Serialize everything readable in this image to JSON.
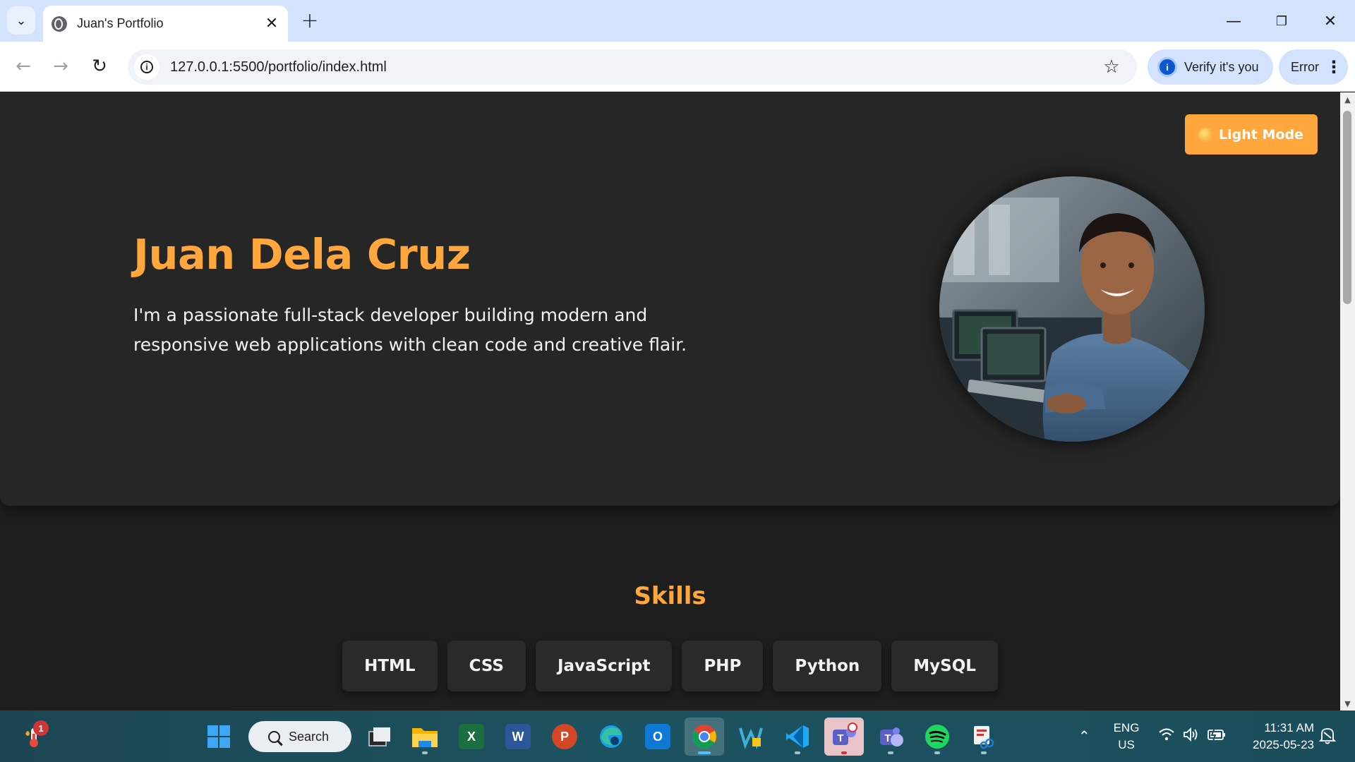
{
  "browser": {
    "tab": {
      "title": "Juan's Portfolio"
    },
    "url": "127.0.0.1:5500/portfolio/index.html",
    "verify_label": "Verify it's you",
    "error_label": "Error"
  },
  "page": {
    "toggle_label": "Light Mode",
    "hero": {
      "name": "Juan Dela Cruz",
      "bio": "I'm a passionate full-stack developer building modern and responsive web applications with clean code and creative flair."
    },
    "skills": {
      "title": "Skills",
      "items": [
        "HTML",
        "CSS",
        "JavaScript",
        "PHP",
        "Python",
        "MySQL"
      ]
    }
  },
  "taskbar": {
    "search_label": "Search",
    "weather_badge": "1",
    "apps": [
      "file-explorer",
      "excel",
      "word",
      "powerpoint",
      "edge",
      "outlook",
      "chrome",
      "app-w",
      "vscode",
      "teams",
      "teams-classic",
      "spotify",
      "snipping-tool"
    ],
    "language": "ENG",
    "region": "US",
    "time": "11:31 AM",
    "date": "2025-05-23"
  },
  "colors": {
    "accent": "#ffa63d",
    "page_bg": "#1e1e1e",
    "hero_bg": "#262626",
    "chrome_tabstrip": "#d3e3fd"
  }
}
